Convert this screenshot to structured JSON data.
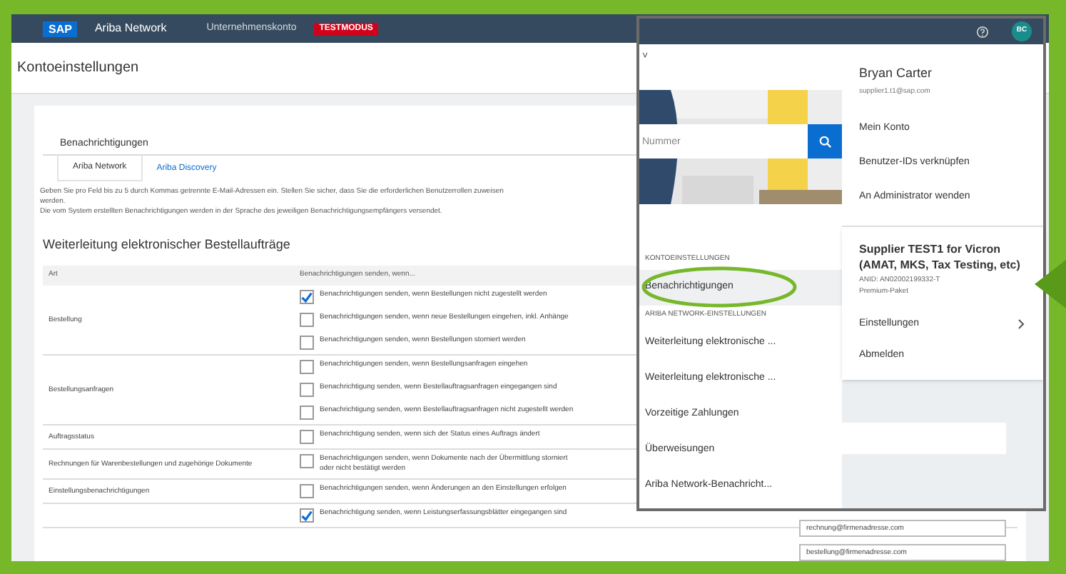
{
  "header": {
    "logo": "SAP",
    "product": "Ariba Network",
    "account": "Unternehmenskonto",
    "mode_badge": "TESTMODUS"
  },
  "page_title": "Kontoeinstellungen",
  "section_title": "Benachrichtigungen",
  "tabs": [
    {
      "label": "Ariba Network",
      "selected": true
    },
    {
      "label": "Ariba Discovery",
      "selected": false
    }
  ],
  "info_lines": [
    "Geben Sie pro Feld bis zu 5 durch Kommas getrennte E-Mail-Adressen ein. Stellen Sie sicher, dass Sie die erforderlichen Benutzerrollen zuweisen",
    "werden.",
    "Die vom System erstellten Benachrichtigungen werden in der Sprache des jeweiligen Benachrichtigungsempfängers versendet."
  ],
  "group_title": "Weiterleitung elektronischer Bestellaufträge",
  "table": {
    "columns": [
      "Art",
      "Benachrichtigungen senden, wenn..."
    ],
    "rows": [
      {
        "type": "Bestellung",
        "options": [
          {
            "text": "Benachrichtigungen senden, wenn Bestellungen nicht zugestellt werden",
            "checked": true
          },
          {
            "text": "Benachrichtigungen senden, wenn neue Bestellungen eingehen, inkl. Anhänge",
            "checked": false
          },
          {
            "text": "Benachrichtigungen senden, wenn Bestellungen storniert werden",
            "checked": false
          }
        ]
      },
      {
        "type": "Bestellungsanfragen",
        "options": [
          {
            "text": "Benachrichtigungen senden, wenn Bestellungsanfragen eingehen",
            "checked": false
          },
          {
            "text": "Benachrichtigung senden, wenn Bestellauftragsanfragen eingegangen sind",
            "checked": false
          },
          {
            "text": "Benachrichtigung senden, wenn Bestellauftragsanfragen nicht zugestellt werden",
            "checked": false
          }
        ]
      },
      {
        "type": "Auftragsstatus",
        "options": [
          {
            "text": "Benachrichtigung senden, wenn sich der Status eines Auftrags ändert",
            "checked": false
          }
        ]
      },
      {
        "type": "Rechnungen für Warenbestellungen und zugehörige Dokumente",
        "options": [
          {
            "text": "Benachrichtigungen senden, wenn Dokumente nach der Übermittlung storniert",
            "checked": false,
            "second_line": "oder nicht bestätigt werden"
          }
        ]
      },
      {
        "type": "Einstellungsbenachrichtigungen",
        "options": [
          {
            "text": "Benachrichtigungen senden, wenn Änderungen an den Einstellungen erfolgen",
            "checked": false
          }
        ]
      },
      {
        "type": "",
        "options": [
          {
            "text": "Benachrichtigung senden, wenn Leistungserfassungsblätter eingegangen sind",
            "checked": true
          }
        ]
      }
    ]
  },
  "email_fields": [
    {
      "value": "rechnung@firmenadresse.com"
    },
    {
      "value": "bestellung@firmenadresse.com"
    }
  ],
  "popup": {
    "search": {
      "placeholder": "Nummer"
    },
    "collapse_glyph": "˅",
    "nav_sections": [
      {
        "title": "KONTOEINSTELLUNGEN",
        "items": [
          {
            "label": "Benachrichtigungen",
            "selected": true
          }
        ]
      },
      {
        "title": "ARIBA NETWORK-EINSTELLUNGEN",
        "items": [
          {
            "label": "Weiterleitung elektronische ...",
            "selected": false
          },
          {
            "label": "Weiterleitung elektronische ...",
            "selected": false
          },
          {
            "label": "Vorzeitige Zahlungen",
            "selected": false
          },
          {
            "label": "Überweisungen",
            "selected": false
          },
          {
            "label": "Ariba Network-Benachricht...",
            "selected": false
          }
        ]
      }
    ],
    "avatar": "BC",
    "user": {
      "name": "Bryan Carter",
      "email": "supplier1.t1@sap.com"
    },
    "user_menu": [
      "Mein Konto",
      "Benutzer-IDs verknüpfen",
      "An Administrator wenden"
    ],
    "company": {
      "name": "Supplier TEST1 for Vicron (AMAT, MKS, Tax Testing, etc)",
      "anid": "ANID: AN02002199332-T",
      "package": "Premium-Paket"
    },
    "company_menu": [
      {
        "label": "Einstellungen",
        "submenu": true
      },
      {
        "label": "Abmelden",
        "submenu": false
      }
    ]
  }
}
